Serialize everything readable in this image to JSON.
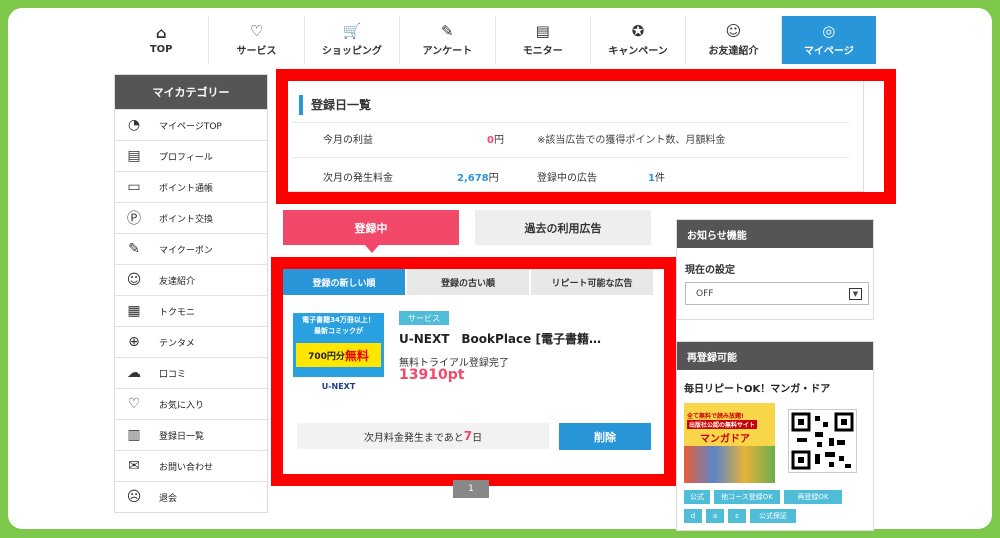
{
  "nav": [
    {
      "label": "TOP",
      "icon": "⌂",
      "name": "home-icon"
    },
    {
      "label": "サービス",
      "icon": "♡",
      "name": "service-icon"
    },
    {
      "label": "ショッピング",
      "icon": "🛒",
      "name": "cart-icon"
    },
    {
      "label": "アンケート",
      "icon": "✎",
      "name": "survey-icon"
    },
    {
      "label": "モニター",
      "icon": "▤",
      "name": "monitor-icon"
    },
    {
      "label": "キャンペーン",
      "icon": "✪",
      "name": "campaign-icon"
    },
    {
      "label": "お友達紹介",
      "icon": "☺",
      "name": "friends-icon"
    },
    {
      "label": "マイページ",
      "icon": "◎",
      "name": "mypage-icon"
    }
  ],
  "sidebar": {
    "title": "マイカテゴリー",
    "items": [
      {
        "label": "マイページTOP",
        "icon": "◔",
        "name": "gauge-icon"
      },
      {
        "label": "プロフィール",
        "icon": "▤",
        "name": "profile-icon"
      },
      {
        "label": "ポイント通帳",
        "icon": "▭",
        "name": "passbook-icon"
      },
      {
        "label": "ポイント交換",
        "icon": "Ⓟ",
        "name": "exchange-icon"
      },
      {
        "label": "マイクーポン",
        "icon": "✎",
        "name": "coupon-icon"
      },
      {
        "label": "友達紹介",
        "icon": "☺",
        "name": "friends-icon"
      },
      {
        "label": "トクモニ",
        "icon": "▦",
        "name": "tokumoni-icon"
      },
      {
        "label": "テンタメ",
        "icon": "⊕",
        "name": "tentame-icon"
      },
      {
        "label": "口コミ",
        "icon": "☁",
        "name": "review-icon"
      },
      {
        "label": "お気に入り",
        "icon": "♡",
        "name": "heart-icon"
      },
      {
        "label": "登録日一覧",
        "icon": "▥",
        "name": "calendar-icon"
      },
      {
        "label": "お問い合わせ",
        "icon": "✉",
        "name": "mail-icon"
      },
      {
        "label": "退会",
        "icon": "☹",
        "name": "leave-icon"
      }
    ]
  },
  "summary": {
    "title": "登録日一覧",
    "this_month_label": "今月の利益",
    "this_month_value": "0",
    "unit_yen": "円",
    "note": "※該当広告での獲得ポイント数、月額料金",
    "next_month_label": "次月の発生料金",
    "next_month_value": "2,678",
    "active_label": "登録中の広告",
    "active_value": "1",
    "unit_count": "件"
  },
  "tabs": {
    "active": "登録中",
    "past": "過去の利用広告"
  },
  "subtabs": [
    "登録の新しい順",
    "登録の古い順",
    "リピート可能な広告"
  ],
  "ad": {
    "badge": "サービス",
    "title": "U-NEXT　BookPlace [電子書籍…",
    "status": "無料トライアル登録完了",
    "points": "13910pt",
    "due_prefix": "次月料金発生まであと",
    "due_days": "7",
    "due_suffix": "日",
    "delete": "削除",
    "thumb": {
      "line1": "電子書籍34万冊以上！",
      "line2": "最新コミックが",
      "price": "700円分",
      "free": "無料",
      "logo": "U-NEXT"
    }
  },
  "pager": "1",
  "notice": {
    "title": "お知らせ機能",
    "setting_label": "現在の設定",
    "setting_value": "OFF"
  },
  "repeat": {
    "title": "再登録可能",
    "ad_title": "毎日リピートOK！マンガ・ドア",
    "tags": [
      "公式",
      "他コース登録OK",
      "再登録OK",
      "d",
      "a",
      "s",
      "公式保証"
    ],
    "banner": {
      "line1": "全て無料で読み放題!",
      "line2": "出版社公認の無料サイト",
      "brand": "マンガドア"
    }
  },
  "colors": {
    "accent": "#2896d8",
    "pink": "#f2496b",
    "frame": "#7dc84a",
    "highlight": "#ff0000"
  }
}
